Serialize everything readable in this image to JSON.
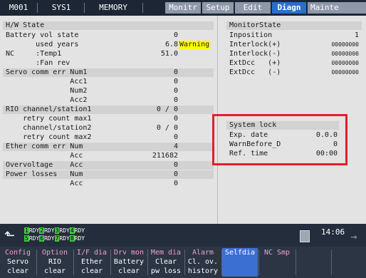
{
  "topbar": {
    "program": "M001",
    "system": "SYS1",
    "mode": "MEMORY",
    "tabs": [
      {
        "label": "Monitr"
      },
      {
        "label": "Setup"
      },
      {
        "label": "Edit"
      },
      {
        "label": "Diagn"
      },
      {
        "label": "Mainte"
      }
    ]
  },
  "left": {
    "section": "H/W State",
    "rows": [
      {
        "label": "Battery vol state",
        "value": "0"
      },
      {
        "label": "       used years",
        "value": "6.8",
        "badge": "Warning"
      },
      {
        "label": "NC     :Temp1",
        "value": "51.0"
      },
      {
        "label": "       :Fan rev",
        "value": ""
      },
      {
        "label": "Servo comm err Num1",
        "value": "0"
      },
      {
        "label": "               Acc1",
        "value": "0"
      },
      {
        "label": "               Num2",
        "value": "0"
      },
      {
        "label": "               Acc2",
        "value": "0"
      },
      {
        "label": "RIO channel/station1",
        "value": "0 / 0"
      },
      {
        "label": "    retry count max1",
        "value": "0"
      },
      {
        "label": "    channel/station2",
        "value": "0 / 0"
      },
      {
        "label": "    retry count max2",
        "value": "0"
      },
      {
        "label": "Ether comm err Num",
        "value": "4"
      },
      {
        "label": "               Acc",
        "value": "211682"
      },
      {
        "label": "Overvoltage    Acc",
        "value": "0"
      },
      {
        "label": "Power losses   Num",
        "value": "0"
      },
      {
        "label": "               Acc",
        "value": "0"
      }
    ]
  },
  "monitor": {
    "title": "MonitorState",
    "rows": [
      {
        "label": "Inposition",
        "value": "1"
      },
      {
        "label": "Interlock(+)",
        "value": "00000000"
      },
      {
        "label": "Interlock(-)",
        "value": "00000000"
      },
      {
        "label": "ExtDcc   (+)",
        "value": "00000000"
      },
      {
        "label": "ExtDcc   (-)",
        "value": "00000000"
      }
    ]
  },
  "syslock": {
    "title": "System lock",
    "rows": [
      {
        "label": "Exp. date",
        "value": "0.0.0"
      },
      {
        "label": "WarnBefore_D",
        "value": "0"
      },
      {
        "label": "Ref. time",
        "value": "00:00"
      }
    ]
  },
  "status": {
    "ready_row1": [
      {
        "n": "1",
        "s": "RDY"
      },
      {
        "n": "2",
        "s": "RDY"
      },
      {
        "n": "3",
        "s": "RDY"
      },
      {
        "n": "4",
        "s": "RDY"
      }
    ],
    "ready_row2": [
      {
        "n": "5",
        "s": "RDY"
      },
      {
        "n": "6",
        "s": "RDY"
      },
      {
        "n": "7",
        "s": "RDY"
      },
      {
        "n": "8",
        "s": "RDY"
      }
    ],
    "clock": "14:06"
  },
  "menu": {
    "groups": [
      {
        "label": "Config"
      },
      {
        "label": "Option"
      },
      {
        "label": "I/F dia"
      },
      {
        "label": "Drv mon"
      },
      {
        "label": "Mem dia"
      },
      {
        "label": "Alarm"
      },
      {
        "label": "Selfdia"
      },
      {
        "label": "NC Smp"
      }
    ],
    "keys": [
      {
        "l1": "Servo",
        "l2": "clear"
      },
      {
        "l1": "RIO",
        "l2": "clear"
      },
      {
        "l1": "Ether",
        "l2": "clear"
      },
      {
        "l1": "Battery",
        "l2": "clear"
      },
      {
        "l1": "Clear",
        "l2": "pw loss"
      },
      {
        "l1": "Cl. ov.",
        "l2": "history"
      }
    ]
  },
  "colors": {
    "accent": "#2a6fd0",
    "warning": "#ffff00",
    "highlight_box": "#e0202a",
    "ready": "#3ec83e"
  }
}
